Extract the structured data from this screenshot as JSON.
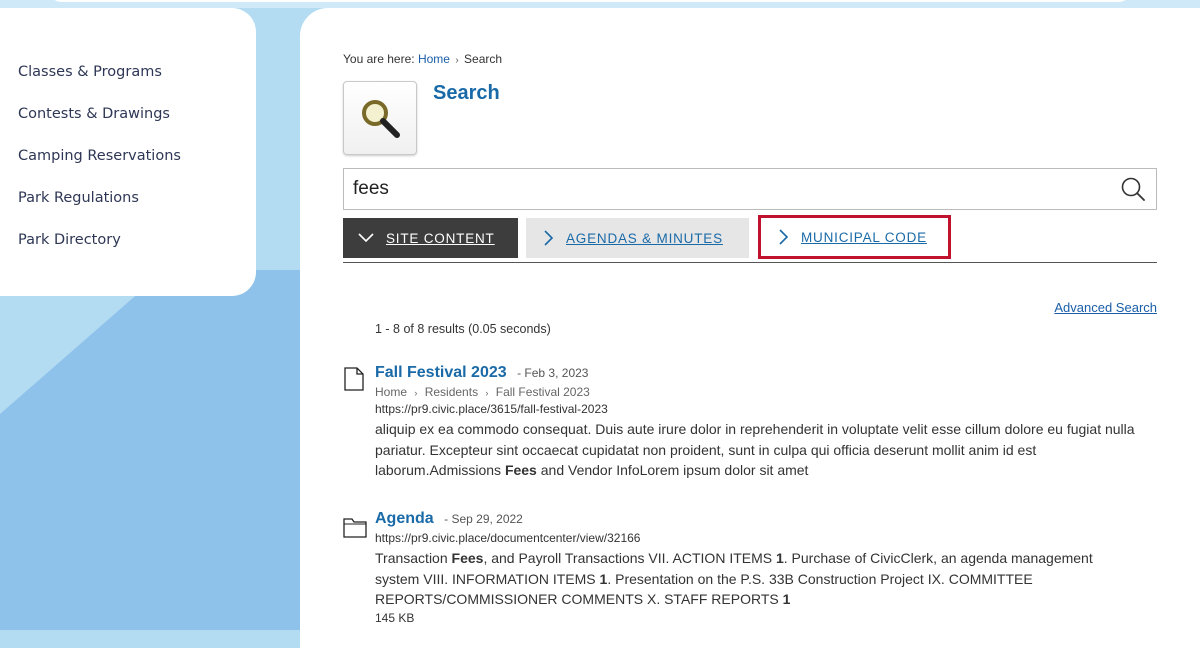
{
  "sidebar": {
    "items": [
      {
        "label": "Classes & Programs"
      },
      {
        "label": "Contests & Drawings"
      },
      {
        "label": "Camping Reservations"
      },
      {
        "label": "Park Regulations"
      },
      {
        "label": "Park Directory"
      }
    ]
  },
  "breadcrumb": {
    "prefix": "You are here:",
    "home": "Home",
    "separator": "›",
    "current": "Search"
  },
  "page": {
    "title": "Search",
    "icon": "magnifier-icon"
  },
  "search": {
    "value": "fees",
    "icon": "search-icon"
  },
  "tabs": [
    {
      "label": "SITE CONTENT",
      "state": "expanded"
    },
    {
      "label": "AGENDAS & MINUTES",
      "state": "collapsed"
    },
    {
      "label": "MUNICIPAL CODE",
      "state": "collapsed",
      "highlighted": true
    }
  ],
  "results_meta": {
    "advanced_search": "Advanced Search",
    "count_text": "1 - 8 of 8 results (0.05 seconds)"
  },
  "results": [
    {
      "icon": "page-icon",
      "title": "Fall Festival 2023",
      "date": "- Feb 3, 2023",
      "crumbs": [
        "Home",
        "Residents",
        "Fall Festival 2023"
      ],
      "url": "https://pr9.civic.place/3615/fall-festival-2023",
      "desc_before": "aliquip ex ea commodo consequat. Duis aute irure dolor in reprehenderit in voluptate velit esse cillum dolore eu fugiat nulla pariatur. Excepteur sint occaecat cupidatat non proident, sunt in culpa qui officia deserunt mollit anim id est laborum.Admissions ",
      "desc_bold": "Fees",
      "desc_after": " and Vendor InfoLorem ipsum dolor sit amet"
    },
    {
      "icon": "folder-icon",
      "title": "Agenda",
      "date": "- Sep 29, 2022",
      "url": "https://pr9.civic.place/documentcenter/view/32166",
      "desc_parts": [
        {
          "text": "Transaction "
        },
        {
          "text": "Fees",
          "bold": true
        },
        {
          "text": ", and Payroll Transactions VII. ACTION ITEMS "
        },
        {
          "text": "1",
          "bold": true
        },
        {
          "text": ". Purchase of CivicClerk, an agenda management system VIII. INFORMATION ITEMS "
        },
        {
          "text": "1",
          "bold": true
        },
        {
          "text": ". Presentation on the P.S. 33B Construction Project IX. COMMITTEE REPORTS/COMMISSIONER COMMENTS X. STAFF REPORTS "
        },
        {
          "text": "1",
          "bold": true
        }
      ],
      "size": "145 KB"
    }
  ],
  "colors": {
    "link": "#1a6aa8",
    "highlight_border": "#c0122c",
    "active_tab": "#3d3d3d",
    "page_background": "#b3dcf3"
  }
}
